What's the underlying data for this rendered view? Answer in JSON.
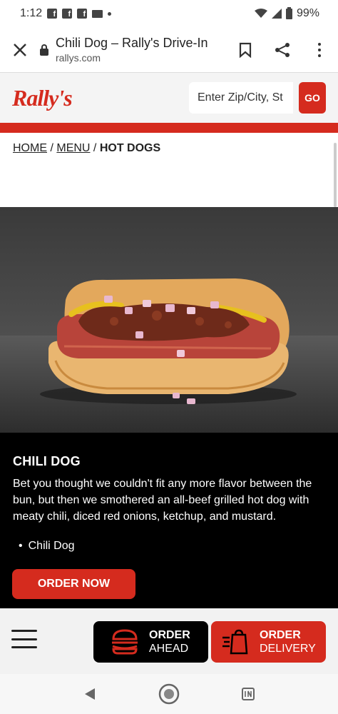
{
  "status_bar": {
    "time": "1:12",
    "battery": "99%",
    "icons": [
      "facebook-icon",
      "facebook-icon",
      "facebook-icon",
      "mail-icon",
      "dot-icon",
      "wifi-icon",
      "signal-icon",
      "battery-icon"
    ]
  },
  "browser": {
    "title": "Chili Dog – Rally's Drive-In",
    "domain": "rallys.com",
    "icons": [
      "close-icon",
      "lock-icon",
      "bookmark-icon",
      "share-icon",
      "more-icon"
    ]
  },
  "header": {
    "logo": "Rally's",
    "search_placeholder": "Enter Zip/City, St",
    "go_label": "GO"
  },
  "breadcrumb": {
    "home": "HOME",
    "sep1": "/",
    "menu": "MENU",
    "sep2": "/",
    "current": "HOT DOGS"
  },
  "item": {
    "title": "CHILI DOG",
    "description": "Bet you thought we couldn't fit any more flavor between the bun, but then we smothered an all-beef grilled hot dog with meaty chili, diced red onions, ketchup, and mustard.",
    "list": [
      "Chili Dog"
    ],
    "order_now": "ORDER NOW"
  },
  "app_bar": {
    "order_ahead_1": "ORDER",
    "order_ahead_2": "AHEAD",
    "order_delivery_1": "ORDER",
    "order_delivery_2": "DELIVERY"
  },
  "colors": {
    "brand_red": "#d52b1e",
    "black": "#000000"
  }
}
